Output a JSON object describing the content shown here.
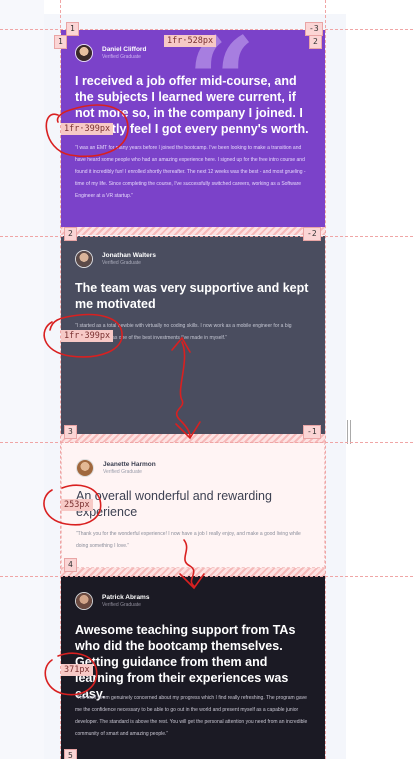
{
  "cards": [
    {
      "name": "Daniel Clifford",
      "role": "Verified Graduate",
      "headline": "I received a job offer mid-course, and the subjects I learned were current, if not more so, in the company I joined. I honestly feel I got every penny's worth.",
      "body": "“I was an EMT for many years before I joined the bootcamp. I've been looking to make a transition and have heard some people who had an amazing experience here. I signed up for the free intro course and found it incredibly fun! I enrolled shortly thereafter. The next 12 weeks was the best - and most grueling - time of my life. Since completing the course, I've successfully switched careers, working as a Software Engineer at a VR startup.”"
    },
    {
      "name": "Jonathan Walters",
      "role": "Verified Graduate",
      "headline": "The team was very supportive and kept me motivated",
      "body": "“I started as a total newbie with virtually no coding skills. I now work as a mobile engineer for a big company. This was one of the best investments I've made in myself.”"
    },
    {
      "name": "Jeanette Harmon",
      "role": "Verified Graduate",
      "headline": "An overall wonderful and rewarding experience",
      "body": "“Thank you for the wonderful experience! I now have a job I really enjoy, and make a good living while doing something I love.”"
    },
    {
      "name": "Patrick Abrams",
      "role": "Verified Graduate",
      "headline": "Awesome teaching support from TAs who did the bootcamp themselves. Getting guidance from them and learning from their experiences was easy.",
      "body": "“The staff seem genuinely concerned about my progress which I find really refreshing. The program gave me the confidence necessary to be able to go out in the world and present myself as a capable junior developer. The standard is above the rest. You will get the personal attention you need from an incredible community of smart and amazing people.”"
    }
  ],
  "grid": {
    "line_labels": [
      "1",
      "1",
      "-3",
      "2",
      "2",
      "-2",
      "3",
      "-1",
      "4",
      "5"
    ],
    "column_size": "1fr·528px",
    "row_sizes": [
      "1fr·399px",
      "1fr·399px",
      "253px",
      "371px"
    ]
  },
  "colors": {
    "card1": "#7b42c9",
    "card2": "#4a4d5f",
    "card3": "#fff4f4",
    "card4": "#1b1a24",
    "grid_overlay": "#f0a5a5"
  }
}
